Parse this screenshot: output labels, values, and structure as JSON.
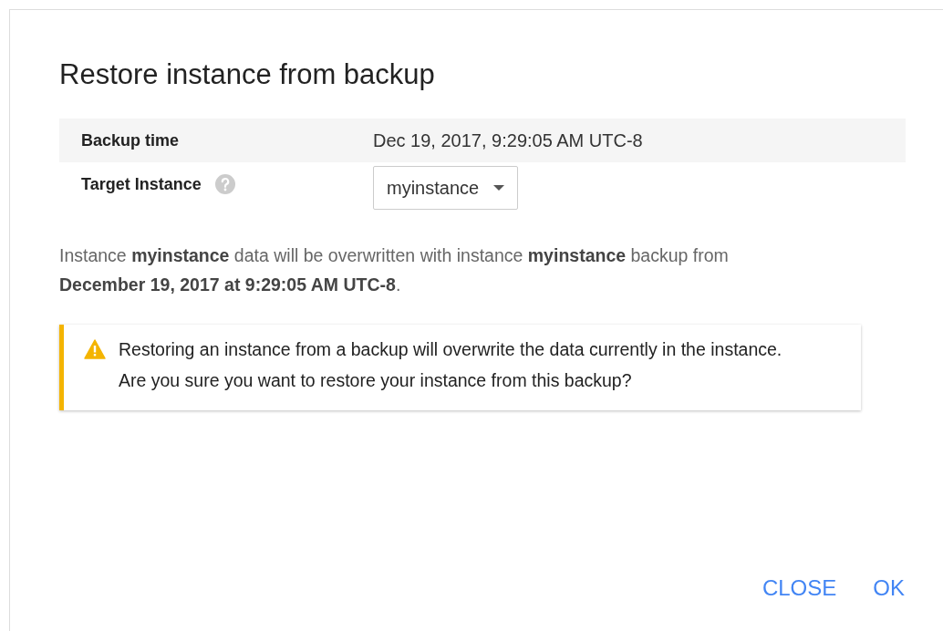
{
  "dialog": {
    "title": "Restore instance from backup",
    "fields": [
      {
        "kind": "text",
        "label": "Backup time",
        "value": "Dec 19, 2017, 9:29:05 AM UTC-8",
        "help": false
      },
      {
        "kind": "select",
        "label": "Target Instance",
        "value": "myinstance",
        "help": true
      }
    ],
    "description": "Instance **myinstance** data will be overwritten with instance **myinstance** backup from **December 19, 2017 at 9:29:05 AM UTC-8**.",
    "warning": {
      "text": "Restoring an instance from a backup will overwrite the data currently in the instance. Are you sure you want to restore your instance from this backup?"
    },
    "buttons": [
      "CLOSE",
      "OK"
    ]
  }
}
